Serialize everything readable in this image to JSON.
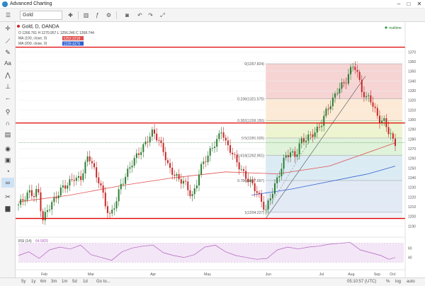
{
  "window": {
    "title": "Advanced Charting",
    "minimize": "–",
    "maximize": "□",
    "close": "✕"
  },
  "toolbar": {
    "symbol": "Gold",
    "icons": [
      "grid-icon",
      "cursor-icon",
      "chart-type-icon",
      "indicators-icon",
      "settings-icon",
      "screenshot-icon",
      "undo-icon",
      "redo-icon",
      "fullscreen-icon"
    ]
  },
  "legend": {
    "title": "Gold, D, OANDA",
    "ohlc": "O 1266.761 H 1270.957 L 1256.246 C 1268.744",
    "ma100_label": "MA (100, close, 0)",
    "ma100_value": "1252.2218",
    "ma200_label": "MA (200, close, 0)",
    "ma200_value": "1239.4376",
    "realtime": "realtime"
  },
  "colors": {
    "up": "#2e7d32",
    "down": "#c62828",
    "ma100": "#e05050",
    "ma200": "#2f5fd0",
    "hline": "#e00000",
    "rsi": "#b060c0"
  },
  "chart_data": {
    "type": "candlestick",
    "symbol": "Gold",
    "timeframe": "D",
    "source": "OANDA",
    "ylim": [
      1180,
      1382
    ],
    "y_ticks": [
      1190,
      1200,
      1210,
      1220,
      1230,
      1240,
      1250,
      1260,
      1270,
      1280,
      1290,
      1300,
      1310,
      1320,
      1330,
      1340,
      1350,
      1360,
      1370
    ],
    "x_labels": [
      "Feb",
      "Mar",
      "Apr",
      "May",
      "Jun",
      "Jul",
      "Aug",
      "Sep",
      "Oct"
    ],
    "close_path": [
      [
        0,
        1212
      ],
      [
        4,
        1218
      ],
      [
        8,
        1225
      ],
      [
        12,
        1222
      ],
      [
        15,
        1228
      ],
      [
        17,
        1210
      ],
      [
        19,
        1196
      ],
      [
        22,
        1206
      ],
      [
        26,
        1214
      ],
      [
        30,
        1222
      ],
      [
        34,
        1230
      ],
      [
        38,
        1233
      ],
      [
        43,
        1240
      ],
      [
        48,
        1238
      ],
      [
        51,
        1252
      ],
      [
        54,
        1262
      ],
      [
        57,
        1256
      ],
      [
        60,
        1240
      ],
      [
        63,
        1236
      ],
      [
        67,
        1212
      ],
      [
        71,
        1200
      ],
      [
        75,
        1214
      ],
      [
        79,
        1232
      ],
      [
        83,
        1242
      ],
      [
        87,
        1254
      ],
      [
        91,
        1262
      ],
      [
        96,
        1271
      ],
      [
        100,
        1280
      ],
      [
        104,
        1288
      ],
      [
        108,
        1279
      ],
      [
        112,
        1268
      ],
      [
        116,
        1250
      ],
      [
        120,
        1244
      ],
      [
        124,
        1238
      ],
      [
        128,
        1236
      ],
      [
        131,
        1228
      ],
      [
        134,
        1220
      ],
      [
        137,
        1230
      ],
      [
        140,
        1248
      ],
      [
        143,
        1256
      ],
      [
        146,
        1262
      ],
      [
        150,
        1272
      ],
      [
        154,
        1280
      ],
      [
        157,
        1290
      ],
      [
        160,
        1276
      ],
      [
        164,
        1268
      ],
      [
        168,
        1258
      ],
      [
        172,
        1248
      ],
      [
        176,
        1240
      ],
      [
        180,
        1234
      ],
      [
        184,
        1226
      ],
      [
        188,
        1214
      ],
      [
        191,
        1206
      ],
      [
        194,
        1218
      ],
      [
        198,
        1232
      ],
      [
        202,
        1246
      ],
      [
        206,
        1262
      ],
      [
        210,
        1266
      ],
      [
        214,
        1262
      ],
      [
        218,
        1278
      ],
      [
        222,
        1280
      ],
      [
        226,
        1284
      ],
      [
        230,
        1288
      ],
      [
        234,
        1296
      ],
      [
        238,
        1310
      ],
      [
        242,
        1318
      ],
      [
        246,
        1330
      ],
      [
        250,
        1336
      ],
      [
        253,
        1340
      ],
      [
        256,
        1350
      ],
      [
        259,
        1358
      ],
      [
        262,
        1346
      ],
      [
        265,
        1332
      ],
      [
        268,
        1320
      ],
      [
        271,
        1326
      ],
      [
        274,
        1312
      ],
      [
        277,
        1306
      ],
      [
        280,
        1296
      ],
      [
        283,
        1300
      ],
      [
        286,
        1286
      ],
      [
        289,
        1280
      ],
      [
        291,
        1276
      ]
    ],
    "candles_count": 170,
    "horizontal_lines": [
      1374.93,
      1296.554,
      1197.88
    ],
    "horizontal_line_labels": [
      "1374.930",
      "1296.554",
      "1197.88"
    ],
    "current_price": 1276.319,
    "current_price_label": "1276.319",
    "fibonacci": [
      {
        "ratio": "0",
        "price": 1357.824,
        "label": "0(1357.824)"
      },
      {
        "ratio": "0.236",
        "price": 1321.575,
        "label": "0.236(1321.575)"
      },
      {
        "ratio": "0.382",
        "price": 1299.15,
        "label": "0.382(1299.150)"
      },
      {
        "ratio": "0.5",
        "price": 1281.026,
        "label": "0.5(1281.026)"
      },
      {
        "ratio": "0.618",
        "price": 1262.901,
        "label": "0.618(1262.901)"
      },
      {
        "ratio": "0.786",
        "price": 1237.097,
        "label": "0.786(1237.097)"
      },
      {
        "ratio": "1",
        "price": 1204.227,
        "label": "1(1204.227)"
      }
    ],
    "fib_band_colors": [
      "#f4cccc",
      "#fde6cf",
      "#eaf2c8",
      "#d9f0d4",
      "#d4e8f2",
      "#dde6f5",
      "#e8e8e8"
    ],
    "ma100": [
      [
        0,
        1215
      ],
      [
        40,
        1222
      ],
      [
        80,
        1232
      ],
      [
        120,
        1240
      ],
      [
        160,
        1246
      ],
      [
        200,
        1244
      ],
      [
        240,
        1252
      ],
      [
        291,
        1276
      ]
    ],
    "ma200": [
      [
        180,
        1222
      ],
      [
        210,
        1228
      ],
      [
        240,
        1236
      ],
      [
        270,
        1244
      ],
      [
        291,
        1252
      ]
    ],
    "rsi": {
      "label": "RSI (14)",
      "value": "64.5825",
      "ylim": [
        20,
        80
      ],
      "y_ticks": [
        60,
        40
      ],
      "values": [
        [
          0,
          44
        ],
        [
          8,
          52
        ],
        [
          16,
          38
        ],
        [
          24,
          56
        ],
        [
          32,
          62
        ],
        [
          40,
          58
        ],
        [
          48,
          66
        ],
        [
          56,
          46
        ],
        [
          64,
          40
        ],
        [
          72,
          34
        ],
        [
          80,
          52
        ],
        [
          88,
          60
        ],
        [
          96,
          64
        ],
        [
          104,
          66
        ],
        [
          112,
          50
        ],
        [
          120,
          44
        ],
        [
          128,
          40
        ],
        [
          136,
          46
        ],
        [
          144,
          62
        ],
        [
          152,
          66
        ],
        [
          160,
          52
        ],
        [
          168,
          44
        ],
        [
          176,
          40
        ],
        [
          184,
          36
        ],
        [
          192,
          38
        ],
        [
          200,
          56
        ],
        [
          208,
          62
        ],
        [
          216,
          58
        ],
        [
          224,
          62
        ],
        [
          232,
          64
        ],
        [
          240,
          68
        ],
        [
          248,
          70
        ],
        [
          256,
          72
        ],
        [
          264,
          56
        ],
        [
          272,
          50
        ],
        [
          280,
          44
        ],
        [
          286,
          36
        ],
        [
          291,
          40
        ]
      ]
    }
  },
  "timebar": {
    "frames": [
      "5y",
      "1y",
      "6m",
      "3m",
      "1m",
      "5d",
      "1d"
    ],
    "goto": "Go to...",
    "clock": "05:10:57 (UTC)",
    "percent": "%",
    "log": "log",
    "auto": "auto"
  }
}
